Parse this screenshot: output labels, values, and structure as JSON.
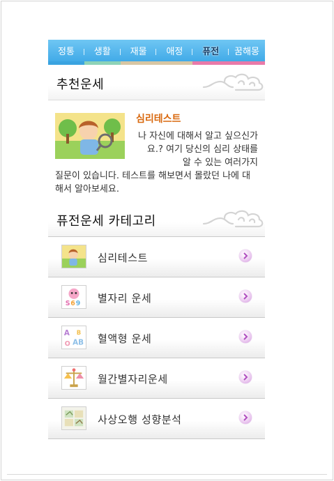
{
  "tabs": [
    {
      "label": "정통"
    },
    {
      "label": "생활"
    },
    {
      "label": "재물"
    },
    {
      "label": "애정"
    },
    {
      "label": "퓨전",
      "active": true
    },
    {
      "label": "꿈해몽"
    }
  ],
  "tab_colors": [
    "#3aa3e0",
    "#8ed3b8",
    "#d6c39e",
    "#d6c39e",
    "#e97aa9",
    "#e97aa9"
  ],
  "recommend": {
    "heading": "추천운세",
    "title": "심리테스트",
    "desc_right": "나 자신에 대해서 알고 싶으신가요.? 여기 당신의 심리 상태를 알 수 있는 여러가지",
    "desc_full": "질문이 있습니다. 테스트를 해보면서 몰랐던 나에 대해서 알아보세요."
  },
  "category": {
    "heading": "퓨전운세 카테고리",
    "items": [
      {
        "label": "심리테스트",
        "icon": "boy-magnifier-icon"
      },
      {
        "label": "별자리 운세",
        "icon": "zodiac-icon"
      },
      {
        "label": "혈액형 운세",
        "icon": "blood-type-icon"
      },
      {
        "label": "월간별자리운세",
        "icon": "libra-scale-icon"
      },
      {
        "label": "사상오행 성향분석",
        "icon": "five-elements-icon"
      }
    ]
  }
}
